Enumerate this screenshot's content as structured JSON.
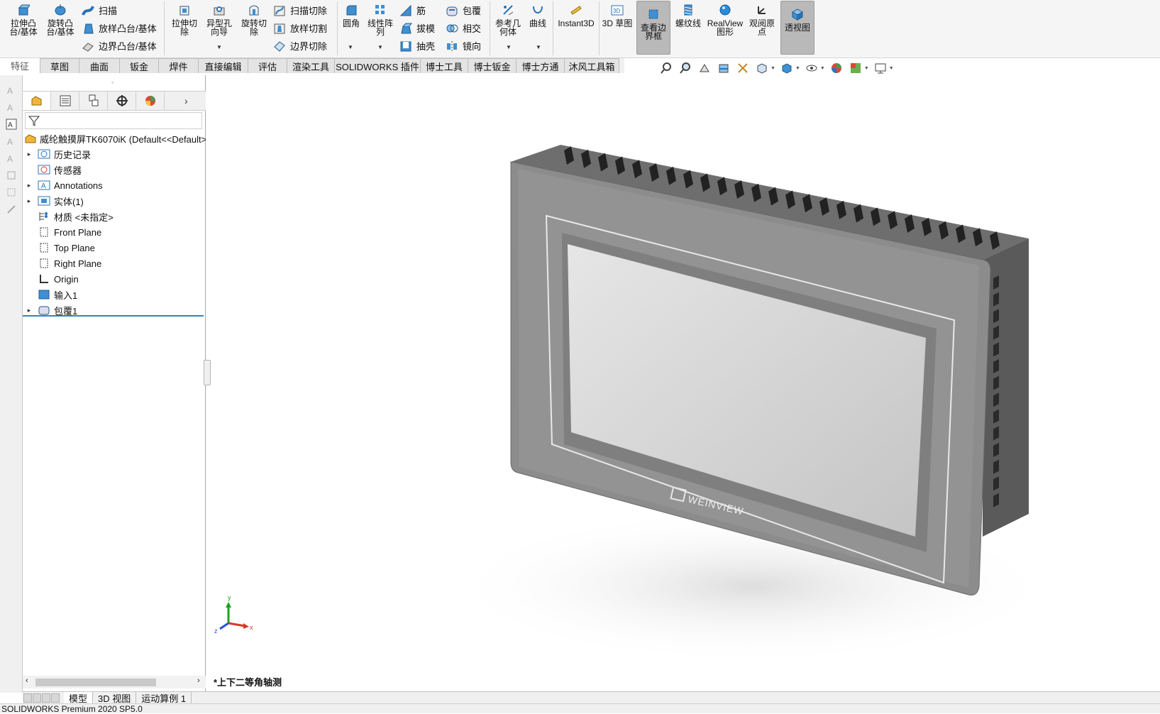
{
  "ribbon": {
    "extrude_boss": "拉伸凸\n台/基体",
    "revolve_boss": "旋转凸\n台/基体",
    "sweep": "扫描",
    "loft_boss": "放样凸台/基体",
    "boundary_boss": "边界凸台/基体",
    "extrude_cut": "拉伸切\n除",
    "hole_wizard": "异型孔\n向导",
    "revolve_cut": "旋转切\n除",
    "swept_cut": "扫描切除",
    "lofted_cut": "放样切割",
    "boundary_cut": "边界切除",
    "fillet": "圆角",
    "linear_pattern": "线性阵\n列",
    "rib": "筋",
    "draft": "拔模",
    "shell": "抽壳",
    "wrap": "包覆",
    "intersect": "相交",
    "mirror": "镜向",
    "ref_geometry": "参考几\n何体",
    "curves": "曲线",
    "instant3d": "Instant3D",
    "sketch3d": "3D 草图",
    "bounding_box": "查看边\n界框",
    "thread": "螺纹线",
    "realview": "RealView\n图形",
    "view_origin": "观阅原\n点",
    "perspective": "透视图"
  },
  "tabs": [
    "特征",
    "草图",
    "曲面",
    "钣金",
    "焊件",
    "直接编辑",
    "评估",
    "渲染工具",
    "SOLIDWORKS 插件",
    "博士工具",
    "博士钣金",
    "博士方通",
    "沐风工具箱"
  ],
  "tree": {
    "root": "威纶触摸屏TK6070iK  (Default<<Default>",
    "items": [
      {
        "label": "历史记录",
        "expand": true
      },
      {
        "label": "传感器",
        "expand": false
      },
      {
        "label": "Annotations",
        "expand": true
      },
      {
        "label": "实体(1)",
        "expand": true
      },
      {
        "label": "材质 <未指定>",
        "expand": false
      },
      {
        "label": "Front Plane",
        "expand": false
      },
      {
        "label": "Top Plane",
        "expand": false
      },
      {
        "label": "Right Plane",
        "expand": false
      },
      {
        "label": "Origin",
        "expand": false
      },
      {
        "label": "输入1",
        "expand": false
      },
      {
        "label": "包覆1",
        "expand": true
      }
    ]
  },
  "viewport": {
    "view_name": "*上下二等角轴测",
    "brand": "WEINVIEW",
    "axis_x": "x",
    "axis_y": "y",
    "axis_z": "z"
  },
  "bottom_tabs": [
    "模型",
    "3D 视图",
    "运动算例 1"
  ],
  "status": "SOLIDWORKS Premium 2020 SP5.0",
  "colors": {
    "accent": "#3c7fc1",
    "bezel": "#8a8a8a",
    "screen": "#d0d0d0"
  }
}
